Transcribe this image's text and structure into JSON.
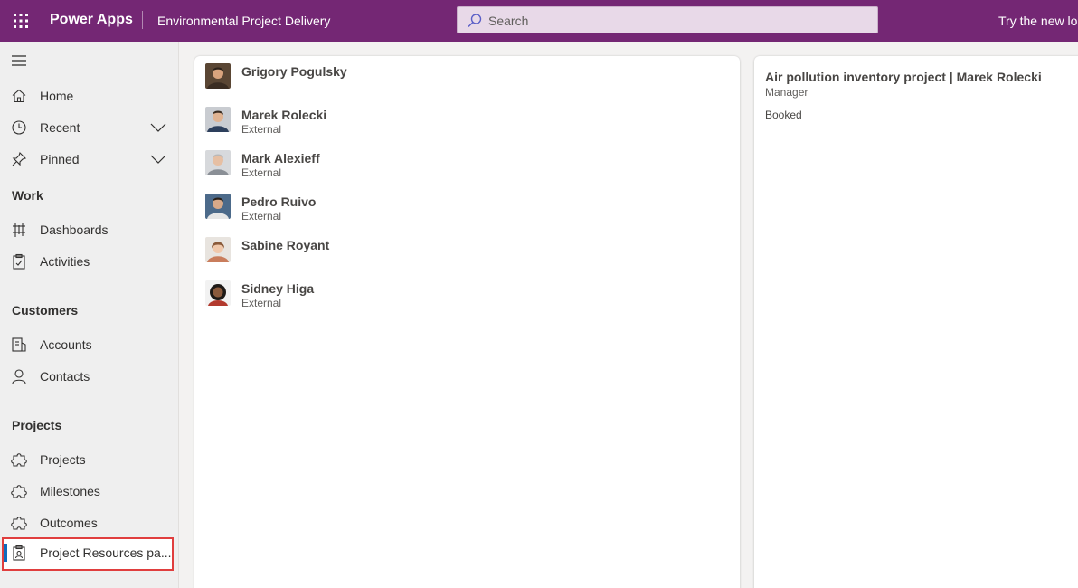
{
  "topbar": {
    "app_name": "Power Apps",
    "environment": "Environmental Project Delivery",
    "search_placeholder": "Search",
    "try_new": "Try the new lo",
    "bar_color": "#742774"
  },
  "sidebar": {
    "items_top": [
      {
        "label": "Home",
        "icon": "home-icon"
      },
      {
        "label": "Recent",
        "icon": "clock-icon"
      },
      {
        "label": "Pinned",
        "icon": "pin-icon"
      }
    ],
    "sections": [
      {
        "title": "Work",
        "items": [
          {
            "label": "Dashboards",
            "icon": "dashboard-icon"
          },
          {
            "label": "Activities",
            "icon": "clipboard-icon"
          }
        ]
      },
      {
        "title": "Customers",
        "items": [
          {
            "label": "Accounts",
            "icon": "building-icon"
          },
          {
            "label": "Contacts",
            "icon": "person-icon"
          }
        ]
      },
      {
        "title": "Projects",
        "items": [
          {
            "label": "Projects",
            "icon": "puzzle-icon"
          },
          {
            "label": "Milestones",
            "icon": "puzzle-icon"
          },
          {
            "label": "Outcomes",
            "icon": "puzzle-icon"
          },
          {
            "label": "Project Resources pa...",
            "icon": "id-badge-icon"
          }
        ]
      }
    ]
  },
  "people": [
    {
      "name": "Grigory Pogulsky",
      "role": ""
    },
    {
      "name": "Marek Rolecki",
      "role": "External"
    },
    {
      "name": "Mark Alexieff",
      "role": "External"
    },
    {
      "name": "Pedro Ruivo",
      "role": "External"
    },
    {
      "name": "Sabine Royant",
      "role": ""
    },
    {
      "name": "Sidney Higa",
      "role": "External"
    }
  ],
  "detail": {
    "title": "Air pollution inventory project | Marek Rolecki",
    "subtitle": "Manager",
    "status": "Booked"
  }
}
